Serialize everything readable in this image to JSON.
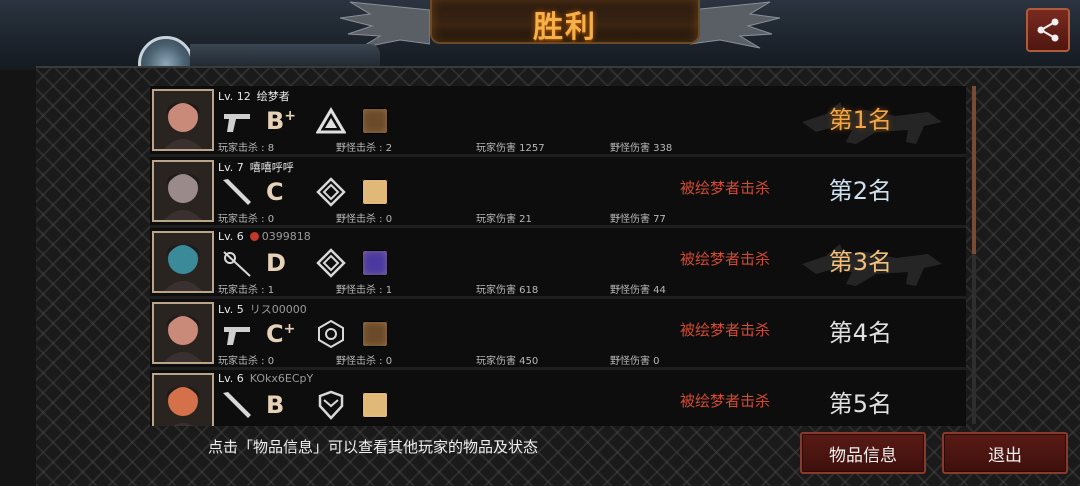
{
  "header": {
    "title": "胜利"
  },
  "players": [
    {
      "level": "Lv. 12",
      "name": "绘梦者",
      "name_gray": false,
      "flag": false,
      "grade": "B",
      "grade_plus": "+",
      "weapon": "pistol",
      "rank": "triangle",
      "player_kills": "玩家击杀 : 8",
      "monster_kills": "野怪击杀 : 2",
      "player_damage": "玩家伤害 1257",
      "monster_damage": "野怪伤害 338",
      "killed_by": "",
      "place": "第1名",
      "place_style": "first",
      "item_color": "#6a4a2a",
      "avatar_color": "#c98a7a"
    },
    {
      "level": "Lv. 7",
      "name": "嘻嘻呼呼",
      "name_gray": false,
      "flag": false,
      "grade": "C",
      "grade_plus": "",
      "weapon": "bat",
      "rank": "diamond",
      "player_kills": "玩家击杀 : 0",
      "monster_kills": "野怪击杀 : 0",
      "player_damage": "玩家伤害 21",
      "monster_damage": "野怪伤害 77",
      "killed_by": "被绘梦者击杀",
      "place": "第2名",
      "place_style": "second",
      "item_color": "#e0b878",
      "avatar_color": "#9a8a8a"
    },
    {
      "level": "Lv. 6",
      "name": "0399818",
      "name_gray": true,
      "flag": true,
      "grade": "D",
      "grade_plus": "",
      "weapon": "rapier",
      "rank": "diamond",
      "player_kills": "玩家击杀 : 1",
      "monster_kills": "野怪击杀 : 1",
      "player_damage": "玩家伤害 618",
      "monster_damage": "野怪伤害 44",
      "killed_by": "被绘梦者击杀",
      "place": "第3名",
      "place_style": "third",
      "item_color": "#4a3aa0",
      "avatar_color": "#3a8a9a"
    },
    {
      "level": "Lv. 5",
      "name": "リス00000",
      "name_gray": true,
      "flag": false,
      "grade": "C",
      "grade_plus": "+",
      "weapon": "pistol",
      "rank": "hexagon",
      "player_kills": "玩家击杀 : 0",
      "monster_kills": "野怪击杀 : 0",
      "player_damage": "玩家伤害 450",
      "monster_damage": "野怪伤害 0",
      "killed_by": "被绘梦者击杀",
      "place": "第4名",
      "place_style": "normal",
      "item_color": "#6a4a2a",
      "avatar_color": "#c98a7a"
    },
    {
      "level": "Lv. 6",
      "name": "KOkx6ECpY",
      "name_gray": true,
      "flag": false,
      "grade": "B",
      "grade_plus": "",
      "weapon": "bat",
      "rank": "shield",
      "player_kills": "",
      "monster_kills": "",
      "player_damage": "",
      "monster_damage": "",
      "killed_by": "被绘梦者击杀",
      "place": "第5名",
      "place_style": "normal",
      "item_color": "#e0b878",
      "avatar_color": "#d4704a"
    }
  ],
  "footer": {
    "hint": "点击「物品信息」可以查看其他玩家的物品及状态",
    "items_button": "物品信息",
    "exit_button": "退出"
  },
  "icons": {
    "share": "share-icon"
  }
}
